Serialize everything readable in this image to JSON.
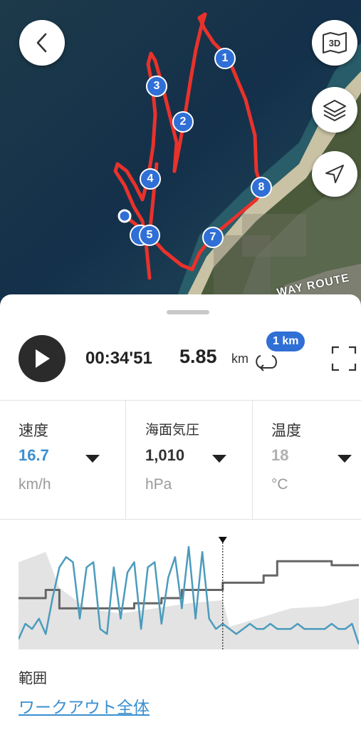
{
  "map": {
    "buttons": {
      "view_3d_label": "3D"
    },
    "markers": [
      "1",
      "2",
      "3",
      "4",
      "5",
      "7",
      "8"
    ],
    "road_label": "WAY ROUTE",
    "route_color": "#e8322b",
    "marker_color": "#2f6fd6"
  },
  "player": {
    "elapsed_time": "00:34'51",
    "distance": "5.85",
    "distance_unit": "km",
    "lap_badge": "1 km"
  },
  "metrics": [
    {
      "label": "速度",
      "value": "16.7",
      "unit": "km/h",
      "value_color": "#3a8fd0"
    },
    {
      "label": "海面気圧",
      "value": "1,010",
      "unit": "hPa",
      "value_color": "#333333"
    },
    {
      "label": "温度",
      "value": "18",
      "unit": "°C",
      "value_color": "#b0b0b0"
    }
  ],
  "chart_data": {
    "type": "line",
    "title": "",
    "xlabel": "",
    "ylabel": "",
    "grid": false,
    "cursor_position": 0.6,
    "series": [
      {
        "color": "#4c9bbd",
        "x": [
          0,
          0.02,
          0.04,
          0.06,
          0.08,
          0.1,
          0.12,
          0.14,
          0.16,
          0.18,
          0.2,
          0.22,
          0.24,
          0.26,
          0.28,
          0.3,
          0.32,
          0.34,
          0.36,
          0.38,
          0.4,
          0.42,
          0.44,
          0.46,
          0.48,
          0.5,
          0.52,
          0.54,
          0.56,
          0.58,
          0.6,
          0.62,
          0.64,
          0.66,
          0.68,
          0.7,
          0.72,
          0.74,
          0.76,
          0.78,
          0.8,
          0.82,
          0.84,
          0.86,
          0.88,
          0.9,
          0.92,
          0.94,
          0.96,
          0.98,
          1
        ],
        "y": [
          0.1,
          0.25,
          0.2,
          0.3,
          0.15,
          0.5,
          0.8,
          0.9,
          0.85,
          0.3,
          0.8,
          0.85,
          0.2,
          0.15,
          0.8,
          0.3,
          0.75,
          0.85,
          0.2,
          0.8,
          0.85,
          0.25,
          0.7,
          0.9,
          0.4,
          1.0,
          0.3,
          0.95,
          0.3,
          0.2,
          0.25,
          0.2,
          0.15,
          0.2,
          0.25,
          0.2,
          0.2,
          0.25,
          0.2,
          0.2,
          0.2,
          0.25,
          0.2,
          0.2,
          0.2,
          0.2,
          0.25,
          0.2,
          0.2,
          0.25,
          0.05
        ]
      },
      {
        "color": "#666666",
        "x": [
          0,
          0.08,
          0.08,
          0.12,
          0.12,
          0.34,
          0.34,
          0.42,
          0.42,
          0.48,
          0.48,
          0.6,
          0.6,
          0.72,
          0.72,
          0.76,
          0.76,
          0.92,
          0.92,
          1
        ],
        "y": [
          0.5,
          0.5,
          0.58,
          0.58,
          0.4,
          0.4,
          0.45,
          0.45,
          0.5,
          0.5,
          0.58,
          0.58,
          0.65,
          0.65,
          0.72,
          0.72,
          0.86,
          0.86,
          0.82,
          0.82
        ]
      },
      {
        "color": "#e3e3e3",
        "x": [
          0,
          0.08,
          0.12,
          0.2,
          0.3,
          0.5,
          0.6,
          0.62,
          0.8,
          0.9,
          1
        ],
        "y": [
          0.85,
          0.95,
          0.6,
          0.4,
          0.35,
          0.45,
          0.48,
          0.22,
          0.4,
          0.42,
          0.5
        ]
      }
    ]
  },
  "range": {
    "label": "範囲",
    "value": "ワークアウト全体"
  }
}
